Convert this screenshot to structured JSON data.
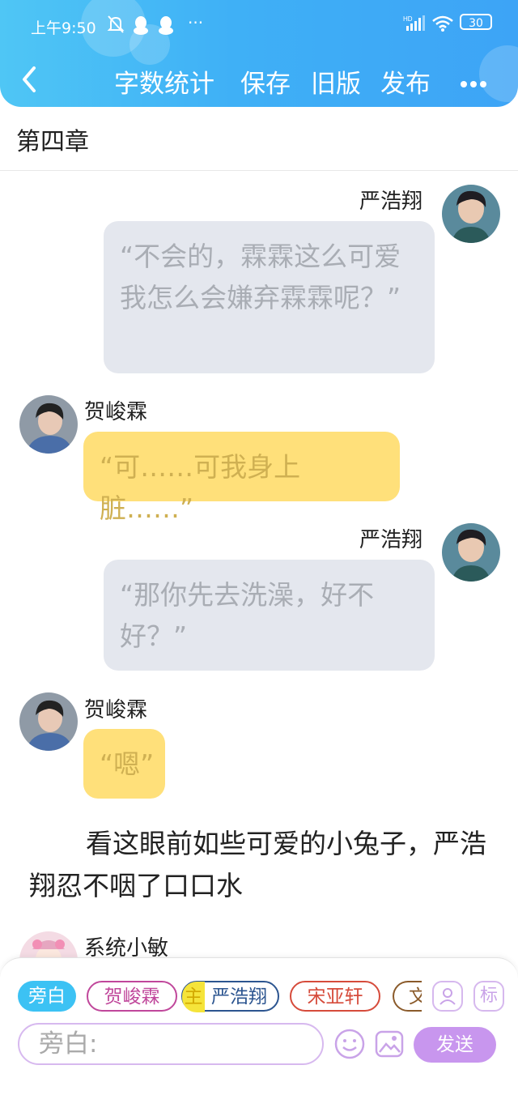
{
  "status_bar": {
    "time": "上午9:50",
    "more": "···",
    "battery": "30",
    "network": "HD"
  },
  "nav": {
    "word_count": "字数统计",
    "save": "保存",
    "old_version": "旧版",
    "publish": "发布",
    "more": "···"
  },
  "chapter_title": "第四章",
  "messages": [
    {
      "speaker": "严浩翔",
      "text": "“不会的，霖霖这么可爱我怎么会嫌弃霖霖呢？”"
    },
    {
      "speaker": "贺峻霖",
      "text": "“可……可我身上脏……”"
    },
    {
      "speaker": "严浩翔",
      "text": "“那你先去洗澡，好不好？”"
    },
    {
      "speaker": "贺峻霖",
      "text": "“嗯”"
    }
  ],
  "narration": "看这眼前如些可爱的小兔子，严浩翔忍不咽了口口水",
  "system_speaker": "系统小敏",
  "role_chips": {
    "narration": "旁白",
    "he": "贺峻霖",
    "main_tag": "主",
    "yan": "严浩翔",
    "song": "宋亚轩",
    "partial": "文"
  },
  "label_icon_text": "标",
  "input": {
    "placeholder": "旁白:"
  },
  "send_label": "发送",
  "colors": {
    "header": "#3fb0f6",
    "gray_bubble": "#e4e7ee",
    "yellow_bubble": "#ffe07a",
    "send_button": "#c896ee",
    "narration_chip": "#3cc2f4"
  }
}
